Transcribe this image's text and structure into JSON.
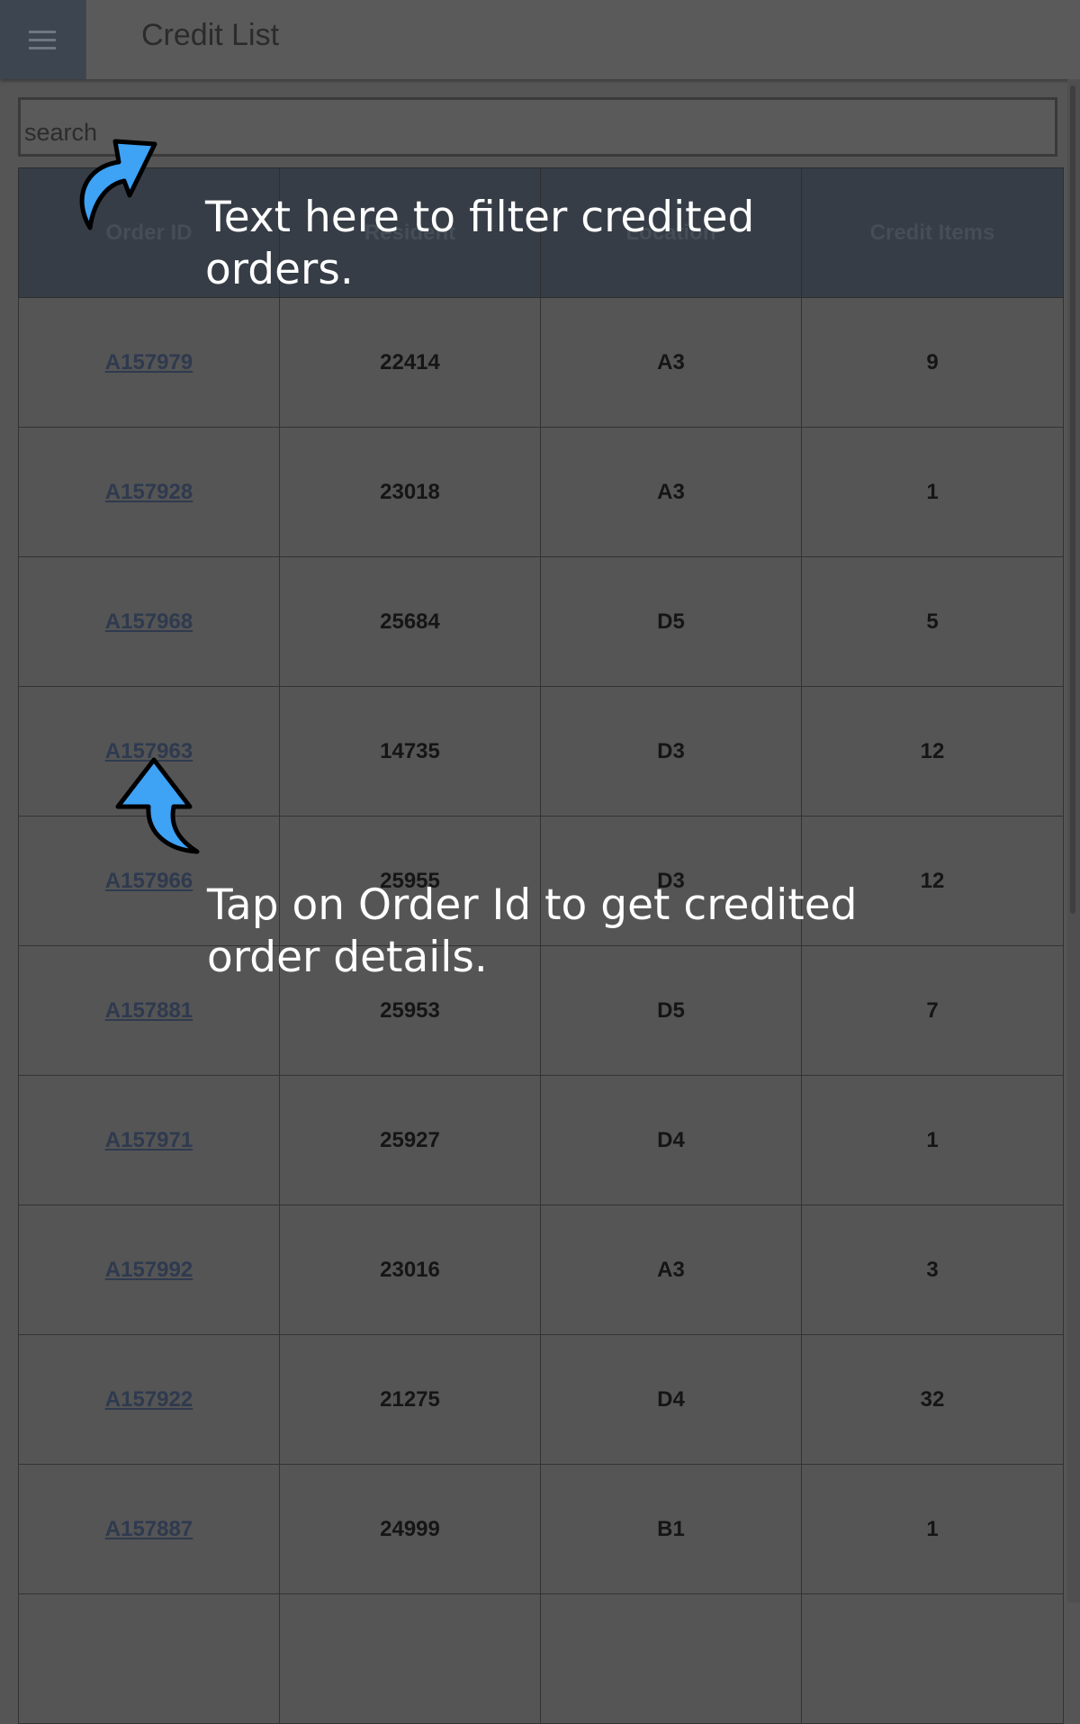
{
  "header": {
    "title": "Credit List",
    "menu_icon": "hamburger-menu-icon"
  },
  "search": {
    "placeholder": "search"
  },
  "table": {
    "columns": [
      "Order ID",
      "Resident",
      "Location",
      "Credit Items"
    ],
    "rows": [
      {
        "order_id": "A157979",
        "resident": "22414",
        "location": "A3",
        "credit_items": "9"
      },
      {
        "order_id": "A157928",
        "resident": "23018",
        "location": "A3",
        "credit_items": "1"
      },
      {
        "order_id": "A157968",
        "resident": "25684",
        "location": "D5",
        "credit_items": "5"
      },
      {
        "order_id": "A157963",
        "resident": "14735",
        "location": "D3",
        "credit_items": "12"
      },
      {
        "order_id": "A157966",
        "resident": "25955",
        "location": "D3",
        "credit_items": "12"
      },
      {
        "order_id": "A157881",
        "resident": "25953",
        "location": "D5",
        "credit_items": "7"
      },
      {
        "order_id": "A157971",
        "resident": "25927",
        "location": "D4",
        "credit_items": "1"
      },
      {
        "order_id": "A157992",
        "resident": "23016",
        "location": "A3",
        "credit_items": "3"
      },
      {
        "order_id": "A157922",
        "resident": "21275",
        "location": "D4",
        "credit_items": "32"
      },
      {
        "order_id": "A157887",
        "resident": "24999",
        "location": "B1",
        "credit_items": "1"
      },
      {
        "order_id": "",
        "resident": "",
        "location": "",
        "credit_items": ""
      }
    ]
  },
  "overlay": {
    "search_tip": {
      "line1": "Text here to filter credited",
      "line2": "orders."
    },
    "order_tip": {
      "line1": "Tap on Order Id to get credited",
      "line2": "order details."
    },
    "arrow_color": "#3ea2f5"
  }
}
